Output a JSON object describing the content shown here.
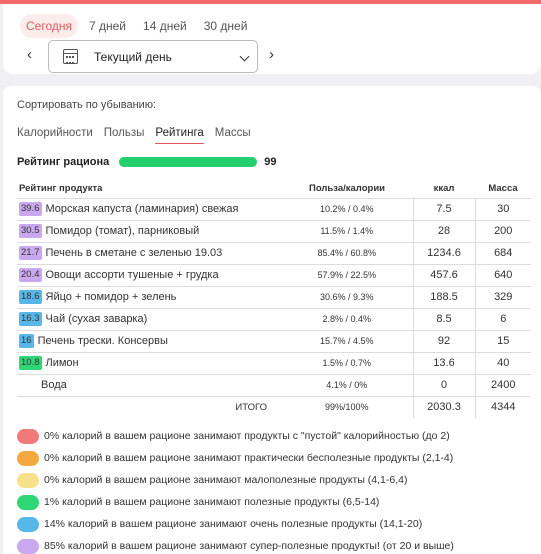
{
  "period_tabs": [
    "Сегодня",
    "7 дней",
    "14 дней",
    "30 дней"
  ],
  "period_active": 0,
  "day_select": {
    "value": "Текущий день"
  },
  "sort": {
    "label": "Сортировать по убыванию:",
    "tabs": [
      "Калорийности",
      "Пользы",
      "Рейтинга",
      "Массы"
    ],
    "active": 2
  },
  "ration_rating": {
    "label": "Рейтинг рациона",
    "value": "99",
    "fraction": 0.99
  },
  "table": {
    "headers": [
      "Рейтинг продукта",
      "Польза/калории",
      "ккал",
      "Масса"
    ],
    "rows": [
      {
        "badge": "39.6",
        "badge_color": "purple",
        "name": "Морская капуста (ламинария) свежая",
        "pc": "10.2% / 0.4%",
        "kcal": "7.5",
        "mass": "30"
      },
      {
        "badge": "30.5",
        "badge_color": "purple",
        "name": "Помидор (томат), парниковый",
        "pc": "11.5% / 1.4%",
        "kcal": "28",
        "mass": "200"
      },
      {
        "badge": "21.7",
        "badge_color": "purple",
        "name": "Печень в сметане с зеленью 19.03",
        "pc": "85.4% / 60.8%",
        "kcal": "1234.6",
        "mass": "684"
      },
      {
        "badge": "20.4",
        "badge_color": "purple",
        "name": "Овощи ассорти тушеные + грудка",
        "pc": "57.9% / 22.5%",
        "kcal": "457.6",
        "mass": "640"
      },
      {
        "badge": "18.6",
        "badge_color": "blue",
        "name": "Яйцо + помидор + зелень",
        "pc": "30.6% / 9.3%",
        "kcal": "188.5",
        "mass": "329"
      },
      {
        "badge": "16.3",
        "badge_color": "blue",
        "name": "Чай (сухая заварка)",
        "pc": "2.8% / 0.4%",
        "kcal": "8.5",
        "mass": "6"
      },
      {
        "badge": "16",
        "badge_color": "blue",
        "name": "Печень трески. Консервы",
        "pc": "15.7% / 4.5%",
        "kcal": "92",
        "mass": "15"
      },
      {
        "badge": "10.8",
        "badge_color": "green",
        "name": "Лимон",
        "pc": "1.5% / 0.7%",
        "kcal": "13.6",
        "mass": "40"
      },
      {
        "badge": "",
        "badge_color": "",
        "name": "Вода",
        "pc": "4.1% / 0%",
        "kcal": "0",
        "mass": "2400"
      }
    ],
    "total": {
      "label": "ИТОГО",
      "pc": "99%/100%",
      "kcal": "2030.3",
      "mass": "4344"
    }
  },
  "legend": [
    {
      "color": "#f07a7a",
      "text": "0% калорий в вашем рационе занимают продукты с \"пустой\" калорийностью (до 2)"
    },
    {
      "color": "#f5a742",
      "text": "0% калорий в вашем рационе занимают практически бесполезные продукты (2,1-4)"
    },
    {
      "color": "#f7e08a",
      "text": "0% калорий в вашем рационе занимают малополезные продукты (4,1-6,4)"
    },
    {
      "color": "#2fd675",
      "text": "1% калорий в вашем рационе занимают полезные продукты (6,5-14)"
    },
    {
      "color": "#57b7e8",
      "text": "14% калорий в вашем рационе занимают очень полезные продукты (14,1-20)"
    },
    {
      "color": "#c9a8f0",
      "text": "85% калорий в вашем рационе занимают супер-полезные продукты! (от 20 и выше)"
    }
  ]
}
